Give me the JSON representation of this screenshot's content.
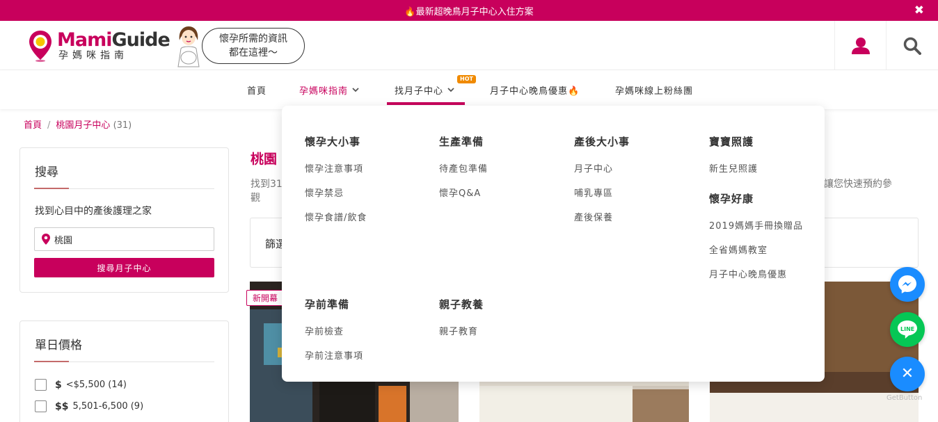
{
  "promo": {
    "text": "🔥最新超晚鳥月子中心入住方案",
    "close": "✖"
  },
  "brand": {
    "name_part1": "Mami",
    "name_part2": "Guide",
    "subtitle": "孕媽咪指南",
    "tagline_line1": "懷孕所需的資訊",
    "tagline_line2": "都在這裡～",
    "color": "#c8005c"
  },
  "nav": {
    "items": [
      {
        "label": "首頁"
      },
      {
        "label": "孕媽咪指南"
      },
      {
        "label": "找月子中心"
      },
      {
        "label": "月子中心晚鳥優惠🔥"
      },
      {
        "label": "孕媽咪線上粉絲團"
      }
    ],
    "hot_badge": "HOT"
  },
  "breadcrumb": {
    "home": "首頁",
    "current": "桃園月子中心",
    "count": "(31)"
  },
  "search_panel": {
    "title": "搜尋",
    "subtitle": "找到心目中的產後護理之家",
    "location_value": "桃園",
    "submit_label": "搜尋月子中心"
  },
  "price_panel": {
    "title": "單日價格",
    "options": [
      {
        "symbol": "$",
        "label": "<$5,500 (14)"
      },
      {
        "symbol": "$$",
        "label": "5,501-6,500 (9)"
      }
    ]
  },
  "main": {
    "title": "桃園",
    "desc_line1": "找到31",
    "desc_line2": "觀",
    "desc_right": "秒讓您快速預約參",
    "filter_label": "篩選",
    "new_badge": "新開幕"
  },
  "dropdown": {
    "groups": [
      {
        "title": "懷孕大小事",
        "links": [
          "懷孕注意事項",
          "懷孕禁忌",
          "懷孕食譜/飲食"
        ]
      },
      {
        "title": "生產準備",
        "links": [
          "待產包準備",
          "懷孕Q&A"
        ]
      },
      {
        "title": "產後大小事",
        "links": [
          "月子中心",
          "哺乳專區",
          "產後保養"
        ]
      },
      {
        "title": "寶寶照護",
        "links": [
          "新生兒照護"
        ]
      },
      {
        "title": "懷孕好康",
        "links": [
          "2019媽媽手冊換贈品",
          "全省媽媽教室",
          "月子中心晚鳥優惠"
        ]
      },
      {
        "title": "孕前準備",
        "links": [
          "孕前檢查",
          "孕前注意事項"
        ]
      },
      {
        "title": "親子教養",
        "links": [
          "親子教育"
        ]
      }
    ]
  },
  "floating": {
    "line_label": "LINE",
    "close_glyph": "✕",
    "get_button": "GetButton"
  },
  "colors": {
    "accent": "#c8005c",
    "messenger": "#1a8cff",
    "line": "#06c755",
    "hot": "#f08a00"
  }
}
